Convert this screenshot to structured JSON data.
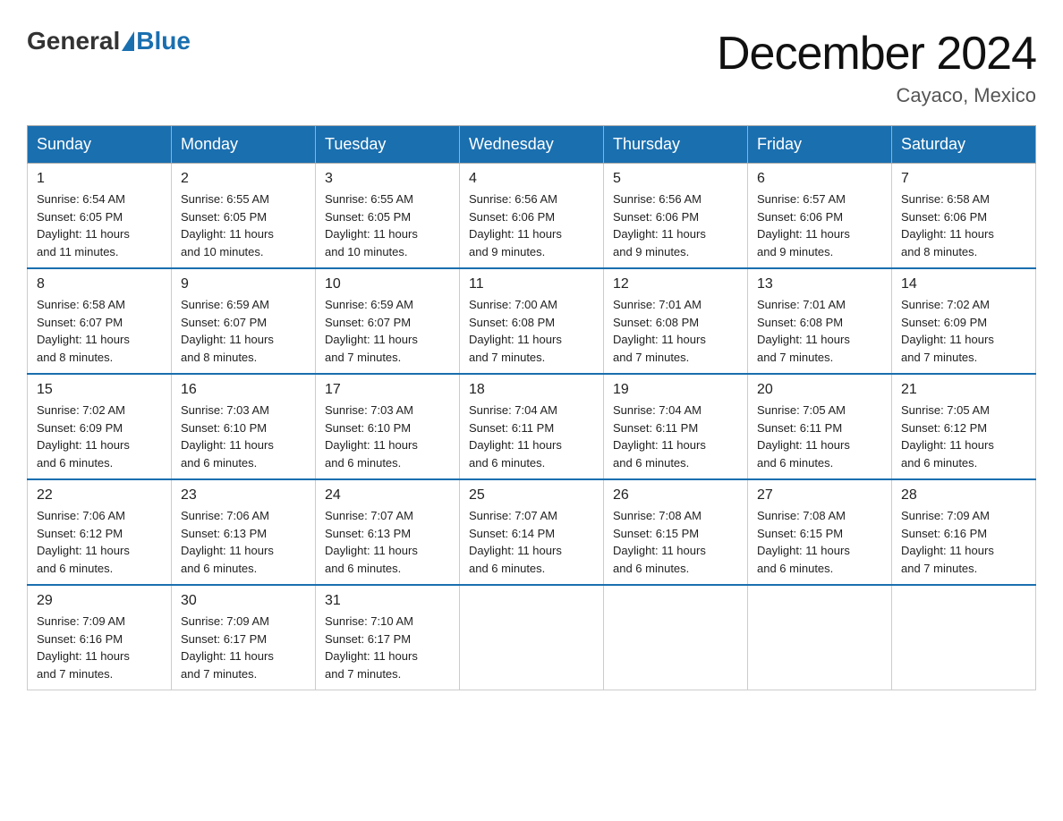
{
  "header": {
    "logo_general": "General",
    "logo_blue": "Blue",
    "month_title": "December 2024",
    "location": "Cayaco, Mexico"
  },
  "days_of_week": [
    "Sunday",
    "Monday",
    "Tuesday",
    "Wednesday",
    "Thursday",
    "Friday",
    "Saturday"
  ],
  "weeks": [
    [
      {
        "day": "1",
        "sunrise": "6:54 AM",
        "sunset": "6:05 PM",
        "daylight": "11 hours and 11 minutes."
      },
      {
        "day": "2",
        "sunrise": "6:55 AM",
        "sunset": "6:05 PM",
        "daylight": "11 hours and 10 minutes."
      },
      {
        "day": "3",
        "sunrise": "6:55 AM",
        "sunset": "6:05 PM",
        "daylight": "11 hours and 10 minutes."
      },
      {
        "day": "4",
        "sunrise": "6:56 AM",
        "sunset": "6:06 PM",
        "daylight": "11 hours and 9 minutes."
      },
      {
        "day": "5",
        "sunrise": "6:56 AM",
        "sunset": "6:06 PM",
        "daylight": "11 hours and 9 minutes."
      },
      {
        "day": "6",
        "sunrise": "6:57 AM",
        "sunset": "6:06 PM",
        "daylight": "11 hours and 9 minutes."
      },
      {
        "day": "7",
        "sunrise": "6:58 AM",
        "sunset": "6:06 PM",
        "daylight": "11 hours and 8 minutes."
      }
    ],
    [
      {
        "day": "8",
        "sunrise": "6:58 AM",
        "sunset": "6:07 PM",
        "daylight": "11 hours and 8 minutes."
      },
      {
        "day": "9",
        "sunrise": "6:59 AM",
        "sunset": "6:07 PM",
        "daylight": "11 hours and 8 minutes."
      },
      {
        "day": "10",
        "sunrise": "6:59 AM",
        "sunset": "6:07 PM",
        "daylight": "11 hours and 7 minutes."
      },
      {
        "day": "11",
        "sunrise": "7:00 AM",
        "sunset": "6:08 PM",
        "daylight": "11 hours and 7 minutes."
      },
      {
        "day": "12",
        "sunrise": "7:01 AM",
        "sunset": "6:08 PM",
        "daylight": "11 hours and 7 minutes."
      },
      {
        "day": "13",
        "sunrise": "7:01 AM",
        "sunset": "6:08 PM",
        "daylight": "11 hours and 7 minutes."
      },
      {
        "day": "14",
        "sunrise": "7:02 AM",
        "sunset": "6:09 PM",
        "daylight": "11 hours and 7 minutes."
      }
    ],
    [
      {
        "day": "15",
        "sunrise": "7:02 AM",
        "sunset": "6:09 PM",
        "daylight": "11 hours and 6 minutes."
      },
      {
        "day": "16",
        "sunrise": "7:03 AM",
        "sunset": "6:10 PM",
        "daylight": "11 hours and 6 minutes."
      },
      {
        "day": "17",
        "sunrise": "7:03 AM",
        "sunset": "6:10 PM",
        "daylight": "11 hours and 6 minutes."
      },
      {
        "day": "18",
        "sunrise": "7:04 AM",
        "sunset": "6:11 PM",
        "daylight": "11 hours and 6 minutes."
      },
      {
        "day": "19",
        "sunrise": "7:04 AM",
        "sunset": "6:11 PM",
        "daylight": "11 hours and 6 minutes."
      },
      {
        "day": "20",
        "sunrise": "7:05 AM",
        "sunset": "6:11 PM",
        "daylight": "11 hours and 6 minutes."
      },
      {
        "day": "21",
        "sunrise": "7:05 AM",
        "sunset": "6:12 PM",
        "daylight": "11 hours and 6 minutes."
      }
    ],
    [
      {
        "day": "22",
        "sunrise": "7:06 AM",
        "sunset": "6:12 PM",
        "daylight": "11 hours and 6 minutes."
      },
      {
        "day": "23",
        "sunrise": "7:06 AM",
        "sunset": "6:13 PM",
        "daylight": "11 hours and 6 minutes."
      },
      {
        "day": "24",
        "sunrise": "7:07 AM",
        "sunset": "6:13 PM",
        "daylight": "11 hours and 6 minutes."
      },
      {
        "day": "25",
        "sunrise": "7:07 AM",
        "sunset": "6:14 PM",
        "daylight": "11 hours and 6 minutes."
      },
      {
        "day": "26",
        "sunrise": "7:08 AM",
        "sunset": "6:15 PM",
        "daylight": "11 hours and 6 minutes."
      },
      {
        "day": "27",
        "sunrise": "7:08 AM",
        "sunset": "6:15 PM",
        "daylight": "11 hours and 6 minutes."
      },
      {
        "day": "28",
        "sunrise": "7:09 AM",
        "sunset": "6:16 PM",
        "daylight": "11 hours and 7 minutes."
      }
    ],
    [
      {
        "day": "29",
        "sunrise": "7:09 AM",
        "sunset": "6:16 PM",
        "daylight": "11 hours and 7 minutes."
      },
      {
        "day": "30",
        "sunrise": "7:09 AM",
        "sunset": "6:17 PM",
        "daylight": "11 hours and 7 minutes."
      },
      {
        "day": "31",
        "sunrise": "7:10 AM",
        "sunset": "6:17 PM",
        "daylight": "11 hours and 7 minutes."
      },
      null,
      null,
      null,
      null
    ]
  ],
  "labels": {
    "sunrise": "Sunrise:",
    "sunset": "Sunset:",
    "daylight": "Daylight:"
  }
}
